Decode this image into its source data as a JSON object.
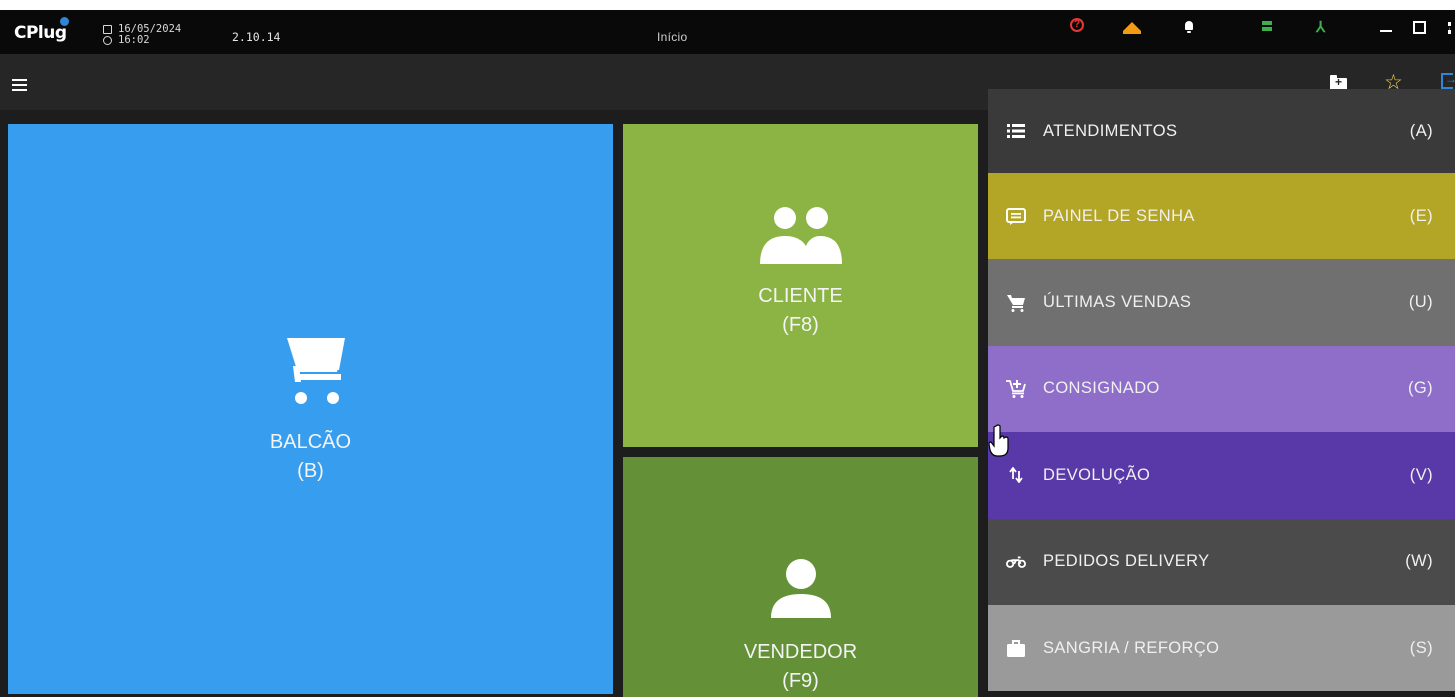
{
  "titlebar": {
    "date": "16/05/2024",
    "time": "16:02",
    "version": "2.10.14",
    "title": "Início",
    "logo": "CPlug"
  },
  "tiles": {
    "balcao": {
      "label": "BALCÃO",
      "key": "(B)",
      "color": "#379dee"
    },
    "cliente": {
      "label": "CLIENTE",
      "key": "(F8)",
      "color": "#8bb445"
    },
    "vendedor": {
      "label": "VENDEDOR",
      "key": "(F9)",
      "color": "#649037"
    }
  },
  "menu": [
    {
      "label": "ATENDIMENTOS",
      "key": "(A)",
      "icon": "list-icon",
      "color": "#3a3a3a"
    },
    {
      "label": "PAINEL DE SENHA",
      "key": "(E)",
      "icon": "ticket-panel-icon",
      "color": "#b3a526"
    },
    {
      "label": "ÚLTIMAS VENDAS",
      "key": "(U)",
      "icon": "cart-icon",
      "color": "#707070"
    },
    {
      "label": "CONSIGNADO",
      "key": "(G)",
      "icon": "cart-plus-icon",
      "color": "#8e6ec8"
    },
    {
      "label": "DEVOLUÇÃO",
      "key": "(V)",
      "icon": "swap-arrows-icon",
      "color": "#5939a8"
    },
    {
      "label": "PEDIDOS DELIVERY",
      "key": "(W)",
      "icon": "motorcycle-icon",
      "color": "#4b4b4b"
    },
    {
      "label": "SANGRIA / REFORÇO",
      "key": "(S)",
      "icon": "briefcase-icon",
      "color": "#9a9a9a"
    }
  ]
}
